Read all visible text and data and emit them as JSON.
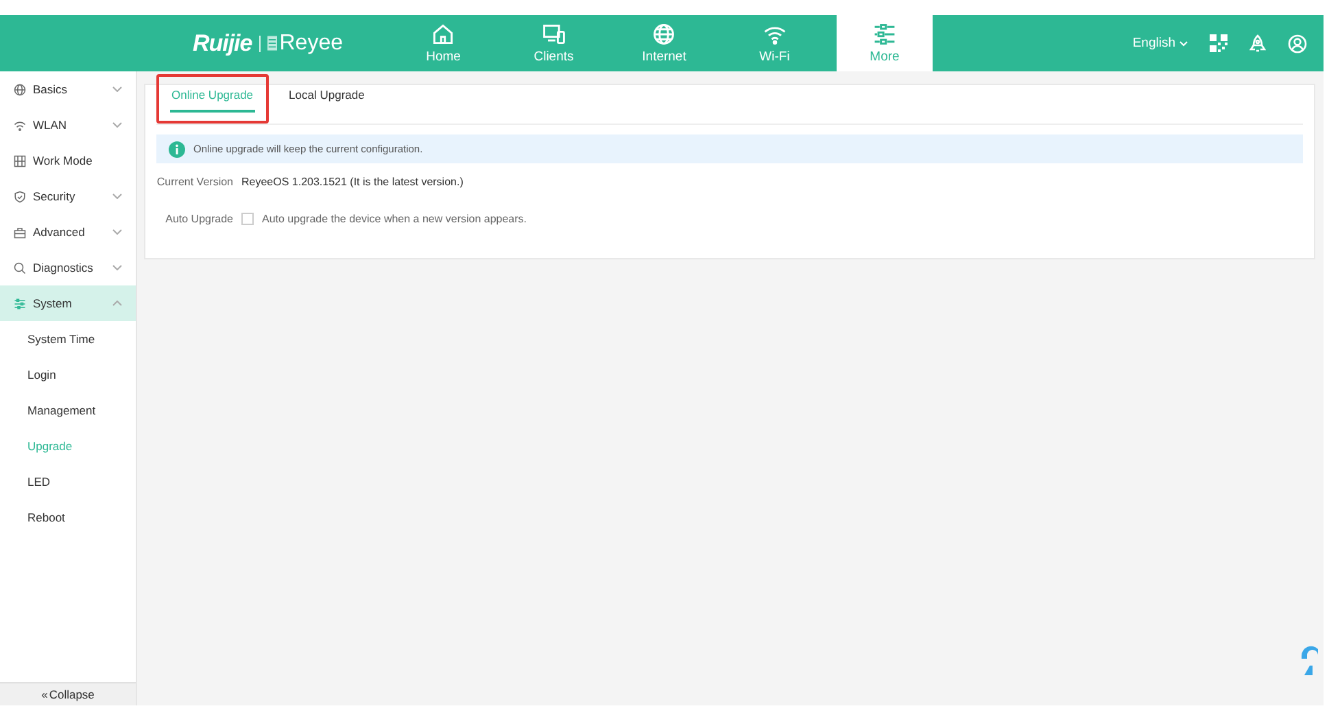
{
  "header": {
    "logo": "Ruijie",
    "brand": "Reyee",
    "language": "English",
    "nav": [
      {
        "label": "Home",
        "selected": false
      },
      {
        "label": "Clients",
        "selected": false
      },
      {
        "label": "Internet",
        "selected": false
      },
      {
        "label": "Wi-Fi",
        "selected": false
      },
      {
        "label": "More",
        "selected": true
      }
    ]
  },
  "sidebar": {
    "items": [
      {
        "label": "Basics",
        "kind": "group",
        "expanded": false,
        "selected": false
      },
      {
        "label": "WLAN",
        "kind": "group",
        "expanded": false,
        "selected": false
      },
      {
        "label": "Work Mode",
        "kind": "link",
        "selected": false
      },
      {
        "label": "Security",
        "kind": "group",
        "expanded": false,
        "selected": false
      },
      {
        "label": "Advanced",
        "kind": "group",
        "expanded": false,
        "selected": false
      },
      {
        "label": "Diagnostics",
        "kind": "group",
        "expanded": false,
        "selected": false
      },
      {
        "label": "System",
        "kind": "group",
        "expanded": true,
        "selected": true,
        "children": [
          {
            "label": "System Time",
            "selected": false
          },
          {
            "label": "Login",
            "selected": false
          },
          {
            "label": "Management",
            "selected": false
          },
          {
            "label": "Upgrade",
            "selected": true
          },
          {
            "label": "LED",
            "selected": false
          },
          {
            "label": "Reboot",
            "selected": false
          }
        ]
      }
    ],
    "collapse": {
      "glyph": "«",
      "label": "Collapse"
    }
  },
  "tabs": [
    {
      "label": "Online Upgrade",
      "selected": true,
      "highlighted": true
    },
    {
      "label": "Local Upgrade",
      "selected": false,
      "highlighted": false
    }
  ],
  "notice": "Online upgrade will keep the current configuration.",
  "current_version": {
    "label": "Current Version",
    "value": "ReyeeOS 1.203.1521 (It is the latest version.)"
  },
  "auto_upgrade": {
    "label": "Auto Upgrade",
    "checked": false,
    "text": "Auto upgrade the device when a new version appears."
  }
}
